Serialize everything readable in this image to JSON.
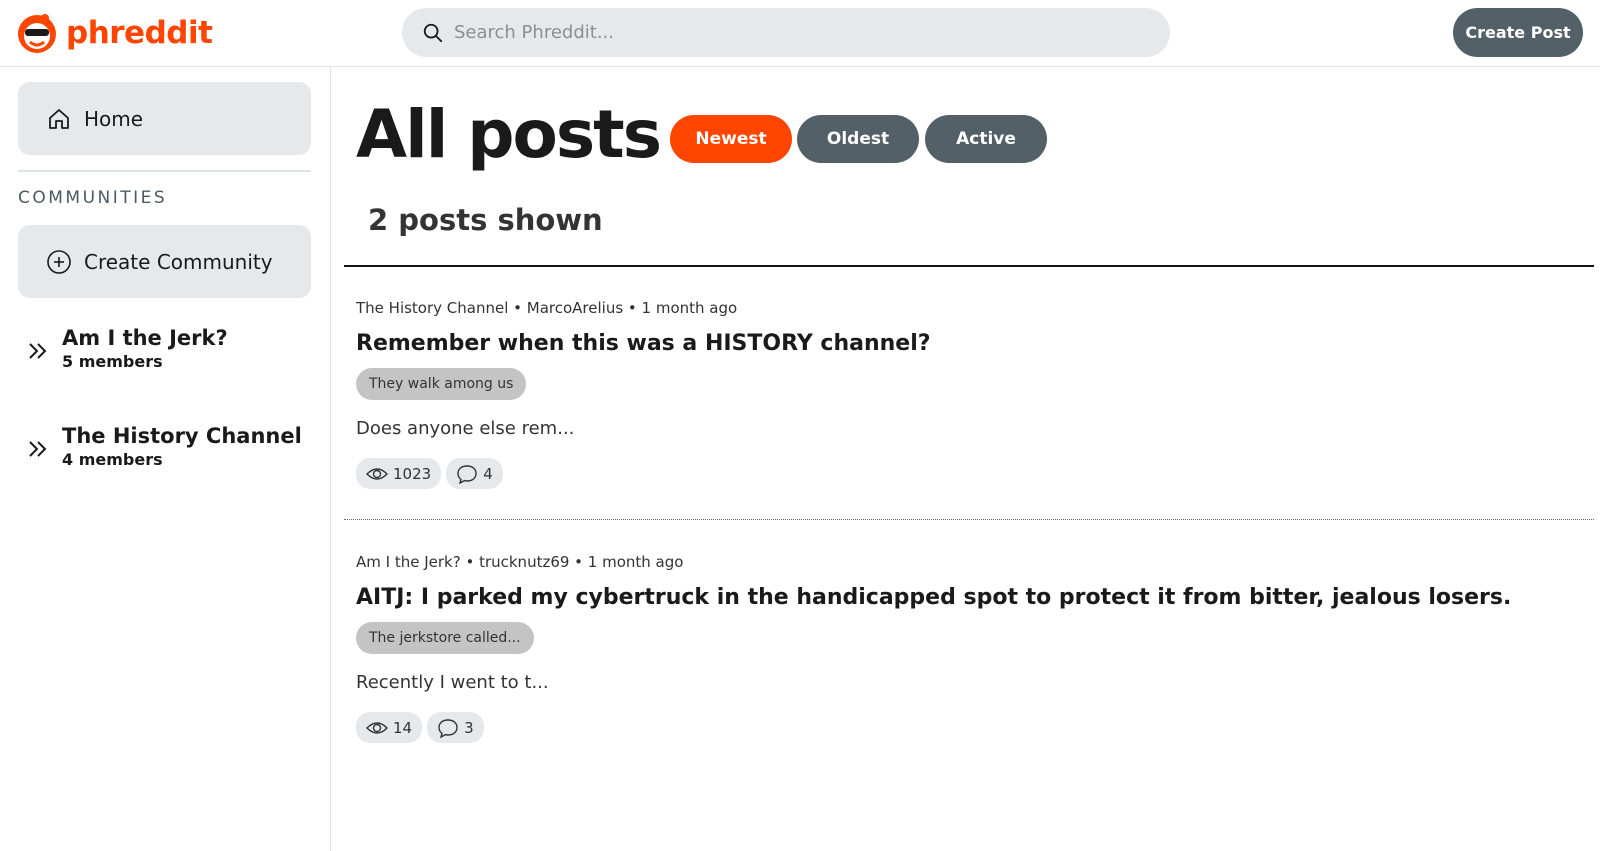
{
  "header": {
    "logo_text": "phreddit",
    "logo_icon": "phreddit-mascot-icon",
    "search_placeholder": "Search Phreddit...",
    "create_post_label": "Create Post"
  },
  "sidebar": {
    "home_label": "Home",
    "communities_label": "COMMUNITIES",
    "create_community_label": "Create Community",
    "communities": [
      {
        "name": "Am I the Jerk?",
        "members": "5 members"
      },
      {
        "name": "The History Channel",
        "members": "4 members"
      }
    ]
  },
  "main": {
    "title": "All posts",
    "sort_buttons": {
      "newest": "Newest",
      "oldest": "Oldest",
      "active": "Active"
    },
    "posts_count": "2 posts shown",
    "posts": [
      {
        "meta": "The History Channel • MarcoArelius • 1 month ago",
        "title": "Remember when this was a HISTORY channel?",
        "flair": "They walk among us",
        "preview": "Does anyone else rem...",
        "views": "1023",
        "comments": "4"
      },
      {
        "meta": "Am I the Jerk? • trucknutz69 • 1 month ago",
        "title": "AITJ: I parked my cybertruck in the handicapped spot to protect it from bitter, jealous losers.",
        "flair": "The jerkstore called...",
        "preview": "Recently I went to t...",
        "views": "14",
        "comments": "3"
      }
    ]
  },
  "colors": {
    "accent": "#ff4500",
    "button_dark": "#536068",
    "chip_bg": "#e5e9ec",
    "flair_bg": "#c4c4c4"
  }
}
